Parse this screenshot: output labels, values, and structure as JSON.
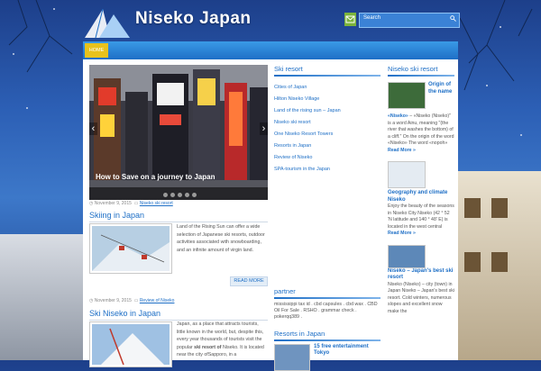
{
  "site": {
    "logo_text": "Niseko Japan"
  },
  "search": {
    "placeholder": "Search"
  },
  "nav": {
    "home": "HOME"
  },
  "slider": {
    "caption": "How to Save on a journey to Japan",
    "dots": 5
  },
  "posts": [
    {
      "date": "November 9, 2015",
      "category": "Niseko ski resort",
      "title": "Skiing in Japan",
      "excerpt": "Land of the Rising Sun can offer a wide selection of Japanese ski resorts, outdoor activities associated with snowboarding, and an infinite amount of virgin land.",
      "more": "READ MORE"
    },
    {
      "date": "November 9, 2015",
      "category": "Review of Niseko",
      "title": "Ski Niseko in Japan",
      "excerpt_parts": [
        "Japan, as a place that attracts tourists, little known in the world, but, despite this, every year thousands of tourists visit the popular ",
        "ski resort of",
        " Niseko. It is located near the city ofSapporo, in a"
      ]
    }
  ],
  "ski_resort": {
    "heading": "Ski resort",
    "links": [
      "Cities of Japan",
      "Hilton Niseko Village",
      "Land of the rising sun – Japan",
      "Niseko ski resort",
      "One Niseko Resort Towers",
      "Resorts in Japan",
      "Review of Niseko",
      "SPA-tourism in the Japan"
    ]
  },
  "partner": {
    "heading": "partner",
    "text": "mississippi tax id . cbd capsules . cbd wax . CBD Oil For Sale . RSHO . grammar check . pokerqq389 ."
  },
  "resorts_japan": {
    "heading": "Resorts in Japan",
    "item_title": "15 free entertainment Tokyo"
  },
  "sidebar": {
    "heading": "Niseko ski resort",
    "items": [
      {
        "title": "Origin of the name",
        "text_parts": [
          "«Niseko»",
          " – «Niseko (Niseko)\" is a word Ainu, meaning \"(the river that washes the bottom) of a cliff.\" On the origin of the word «Niseko» The word «nopoh» "
        ],
        "more": "Read More »"
      },
      {
        "title": "Geography and climate Niseko",
        "text": "Enjoy the beauty of the seasons in Niseko City Niseko (42 ° 52 'N latitude and 140 ° 48' E) is located in the west central ",
        "more": "Read More »"
      },
      {
        "title": "Niseko – Japan's best ski resort",
        "text": "Niseko (Niseko) – city (town) in Japan Niseko – Japan's best ski resort. Cold winters, numerous slopes and excellent snow make the"
      }
    ]
  },
  "colors": {
    "accent": "#1e6fc6",
    "nav_active": "#e8c21c",
    "mail_icon": "#7bb33b"
  }
}
